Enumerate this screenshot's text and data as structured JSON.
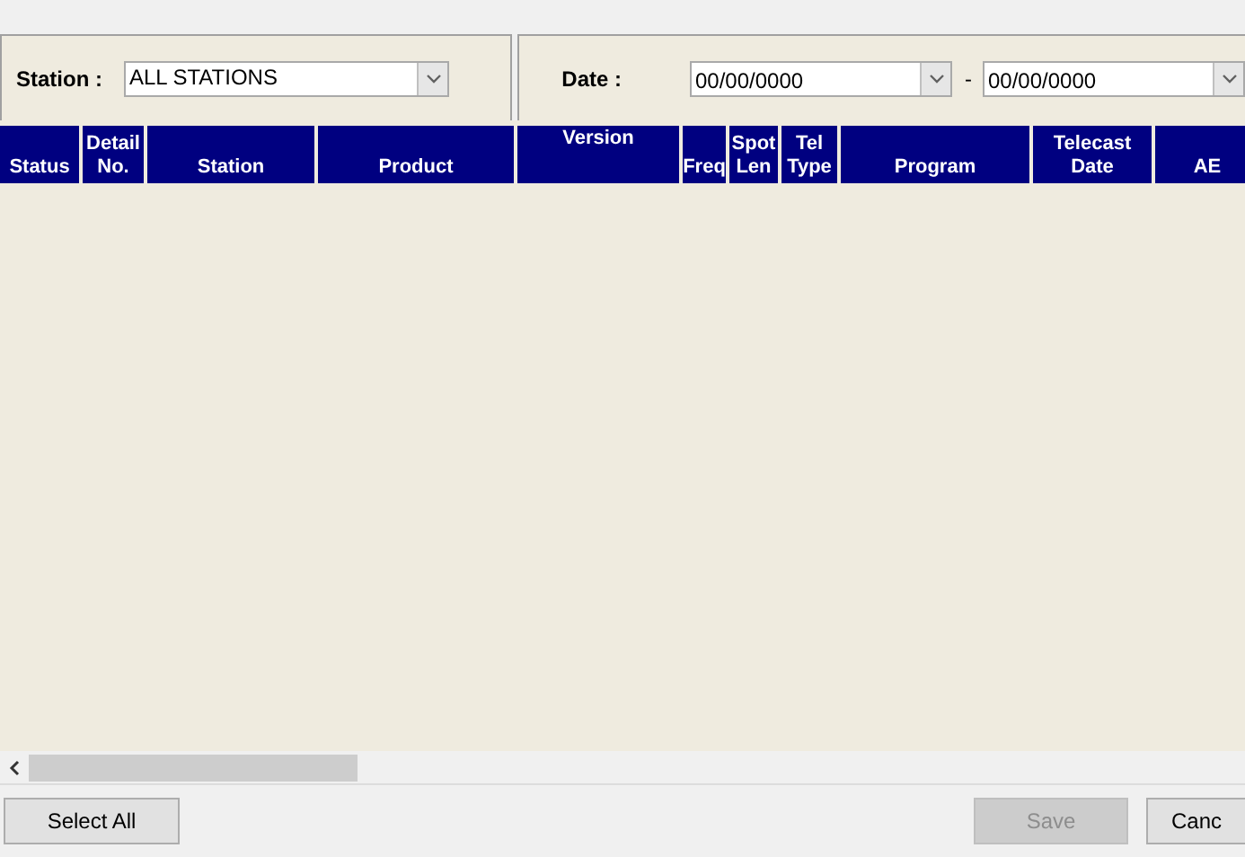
{
  "filters": {
    "station": {
      "label": "Station :",
      "value": "ALL STATIONS"
    },
    "date": {
      "label": "Date :",
      "from": "00/00/0000",
      "separator": "-",
      "to": "00/00/0000"
    }
  },
  "table": {
    "columns": [
      {
        "label": "Status"
      },
      {
        "label": "Detail\nNo."
      },
      {
        "label": "Station"
      },
      {
        "label": "Product"
      },
      {
        "label": "Version"
      },
      {
        "label": "Freq"
      },
      {
        "label": "Spot\nLen"
      },
      {
        "label": "Tel\nType"
      },
      {
        "label": "Program"
      },
      {
        "label": "Telecast\nDate"
      },
      {
        "label": "AE"
      }
    ]
  },
  "buttons": [
    {
      "label": "Select All",
      "disabled": false
    },
    {
      "label": "Save",
      "disabled": true
    },
    {
      "label": "Canc",
      "disabled": false
    }
  ]
}
